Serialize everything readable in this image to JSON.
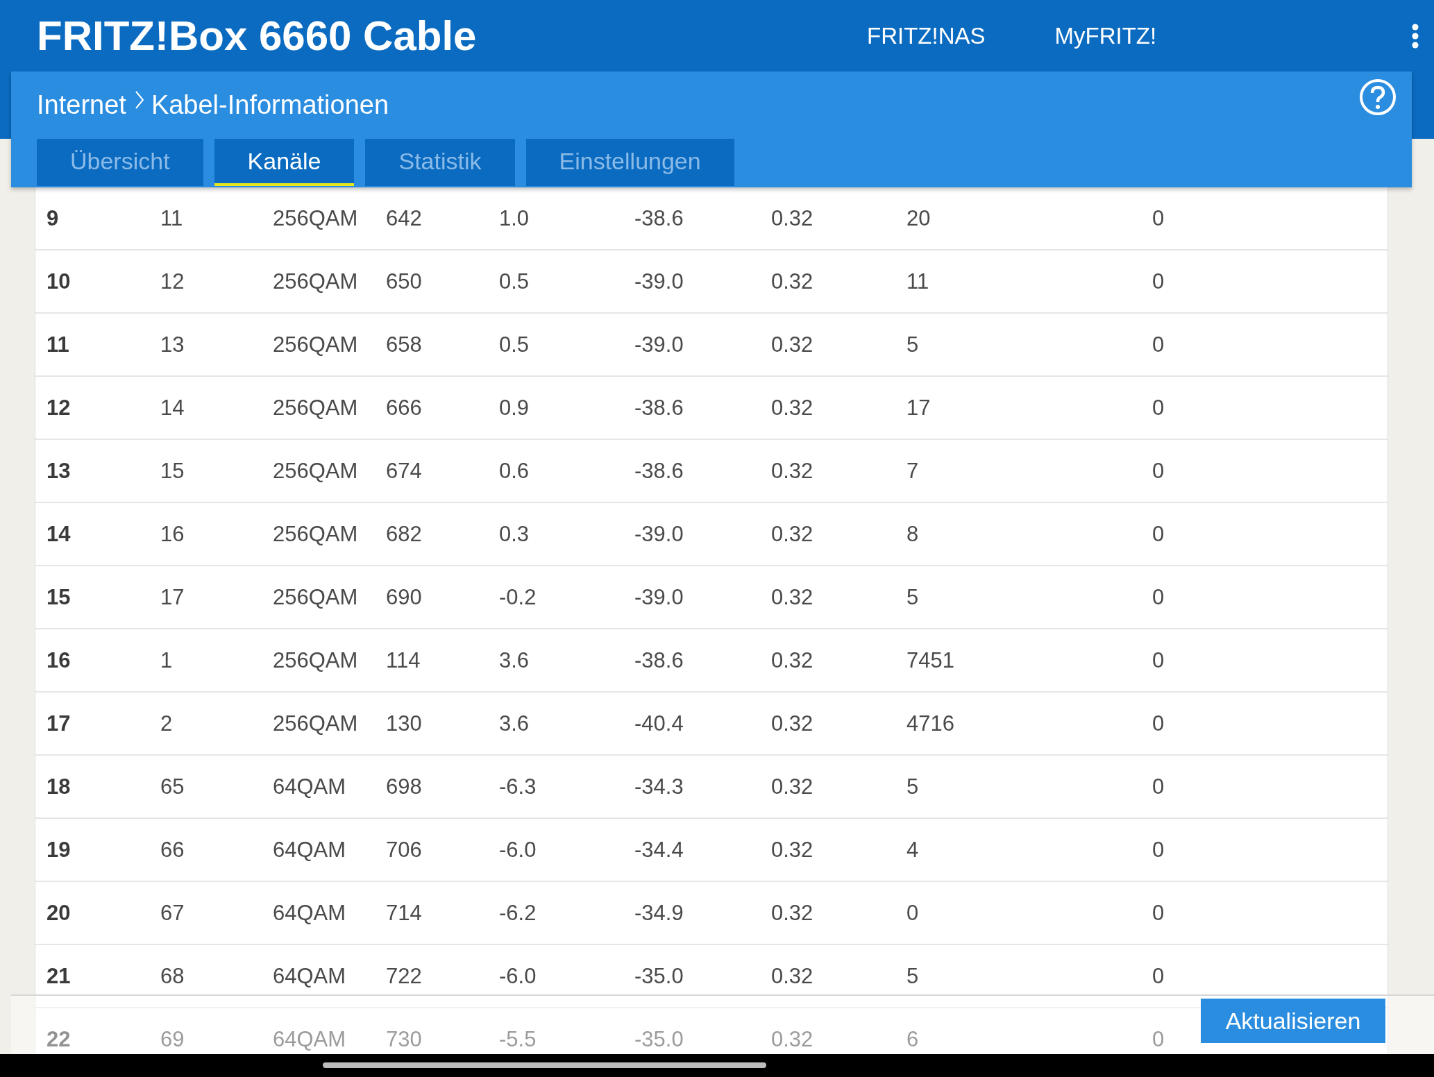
{
  "header": {
    "title": "FRITZ!Box 6660 Cable",
    "links": [
      "FRITZ!NAS",
      "MyFRITZ!"
    ]
  },
  "breadcrumb": {
    "parent": "Internet",
    "current": "Kabel-Informationen"
  },
  "tabs": [
    {
      "label": "Übersicht",
      "selected": false
    },
    {
      "label": "Kanäle",
      "selected": true
    },
    {
      "label": "Statistik",
      "selected": false
    },
    {
      "label": "Einstellungen",
      "selected": false
    }
  ],
  "table": {
    "rows": [
      [
        "9",
        "11",
        "256QAM",
        "642",
        "1.0",
        "-38.6",
        "0.32",
        "20",
        "0"
      ],
      [
        "10",
        "12",
        "256QAM",
        "650",
        "0.5",
        "-39.0",
        "0.32",
        "11",
        "0"
      ],
      [
        "11",
        "13",
        "256QAM",
        "658",
        "0.5",
        "-39.0",
        "0.32",
        "5",
        "0"
      ],
      [
        "12",
        "14",
        "256QAM",
        "666",
        "0.9",
        "-38.6",
        "0.32",
        "17",
        "0"
      ],
      [
        "13",
        "15",
        "256QAM",
        "674",
        "0.6",
        "-38.6",
        "0.32",
        "7",
        "0"
      ],
      [
        "14",
        "16",
        "256QAM",
        "682",
        "0.3",
        "-39.0",
        "0.32",
        "8",
        "0"
      ],
      [
        "15",
        "17",
        "256QAM",
        "690",
        "-0.2",
        "-39.0",
        "0.32",
        "5",
        "0"
      ],
      [
        "16",
        "1",
        "256QAM",
        "114",
        "3.6",
        "-38.6",
        "0.32",
        "7451",
        "0"
      ],
      [
        "17",
        "2",
        "256QAM",
        "130",
        "3.6",
        "-40.4",
        "0.32",
        "4716",
        "0"
      ],
      [
        "18",
        "65",
        "64QAM",
        "698",
        "-6.3",
        "-34.3",
        "0.32",
        "5",
        "0"
      ],
      [
        "19",
        "66",
        "64QAM",
        "706",
        "-6.0",
        "-34.4",
        "0.32",
        "4",
        "0"
      ],
      [
        "20",
        "67",
        "64QAM",
        "714",
        "-6.2",
        "-34.9",
        "0.32",
        "0",
        "0"
      ],
      [
        "21",
        "68",
        "64QAM",
        "722",
        "-6.0",
        "-35.0",
        "0.32",
        "5",
        "0"
      ],
      [
        "22",
        "69",
        "64QAM",
        "730",
        "-5.5",
        "-35.0",
        "0.32",
        "6",
        "0"
      ]
    ]
  },
  "button": "Aktualisieren"
}
